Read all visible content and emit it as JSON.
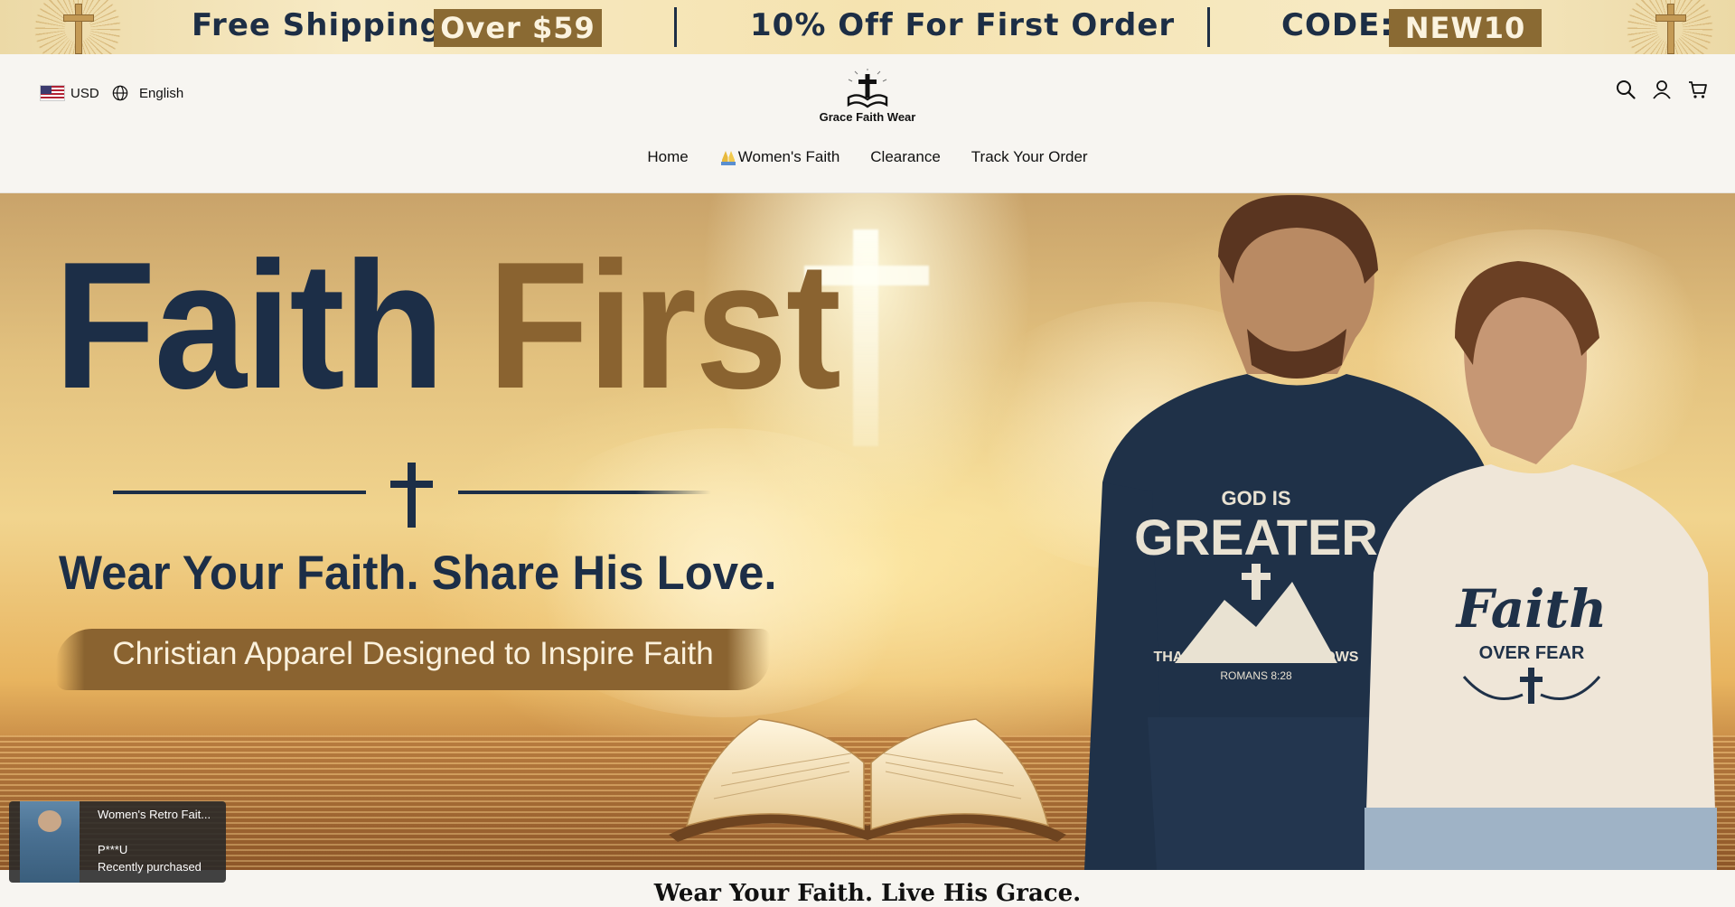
{
  "announcement": {
    "shipping_text": "Free Shipping",
    "shipping_badge": "Over $59",
    "discount_text": "10% Off For First Order",
    "code_label": "CODE:",
    "code_value": "NEW10",
    "decoration_icon": "cross-icon"
  },
  "header": {
    "currency": "USD",
    "currency_flag_icon": "us-flag-icon",
    "language": "English",
    "language_icon": "globe-icon",
    "logo_text": "Grace Faith Wear",
    "icons": [
      "search-icon",
      "account-icon",
      "cart-icon"
    ]
  },
  "nav": {
    "items": [
      {
        "label": "Home"
      },
      {
        "label": "Women's Faith",
        "icon": "praying-hands-icon"
      },
      {
        "label": "Clearance"
      },
      {
        "label": "Track Your Order"
      }
    ]
  },
  "hero": {
    "headline_word1": "Faith",
    "headline_word2": "First",
    "tagline": "Wear Your Faith. Share His Love.",
    "subtitle": "Christian Apparel Designed to Inspire Faith",
    "shirt_left_lines": [
      "GOD IS",
      "GREATER",
      "THAN THE HIGHS AND LOWS",
      "ROMANS 8:28"
    ],
    "shirt_right_lines": [
      "Faith",
      "OVER FEAR"
    ],
    "colors": {
      "navy": "#1c2e47",
      "bronze": "#8a6330"
    }
  },
  "popup": {
    "product_title": "Women's Retro Fait...",
    "buyer": "P***U",
    "status": "Recently purchased"
  },
  "next_section": {
    "heading": "Wear Your Faith. Live His Grace."
  }
}
